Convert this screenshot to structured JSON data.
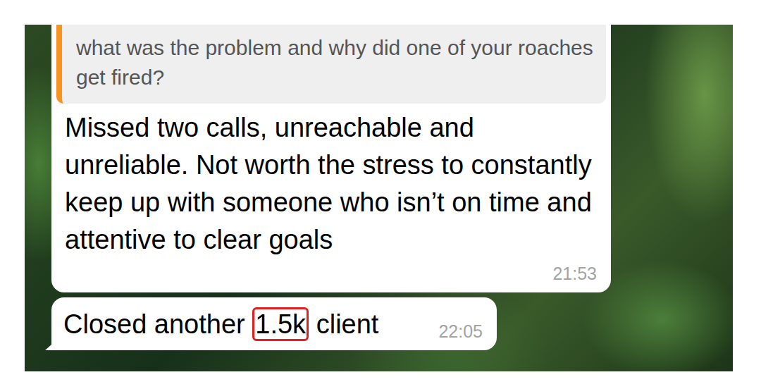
{
  "messages": [
    {
      "kind": "reply",
      "tail": false,
      "reply": {
        "text": "what was the problem and why did one of your roaches get fired?"
      },
      "segments": [
        {
          "text": "Missed two calls, unreachable and unreliable. Not worth the stress to constantly keep up with someone who isn’t on time and attentive to clear goals",
          "highlighted": false
        }
      ],
      "time": "21:53"
    },
    {
      "kind": "plain",
      "tail": true,
      "segments": [
        {
          "text": "Closed another ",
          "highlighted": false
        },
        {
          "text": "1.5k",
          "highlighted": true
        },
        {
          "text": " client",
          "highlighted": false
        }
      ],
      "time": "22:05"
    }
  ]
}
